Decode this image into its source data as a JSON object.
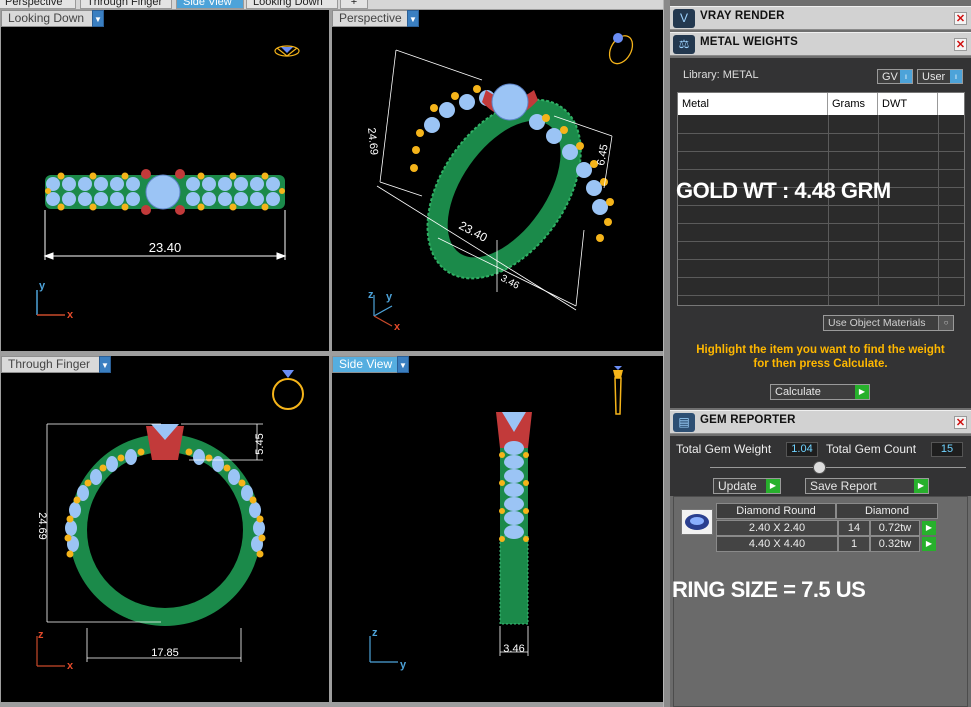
{
  "tabs": [
    "Perspective",
    "Through Finger",
    "Side View",
    "Looking Down",
    "+"
  ],
  "active_tab": "Side View",
  "viewports": {
    "top_left": {
      "label": "Looking Down",
      "dims": {
        "width": "23.40"
      },
      "axes": {
        "v": "y",
        "h": "x"
      }
    },
    "top_right": {
      "label": "Perspective",
      "dims": {
        "height": "24.69",
        "length": "23.40",
        "side": "6.45",
        "width": "3.46"
      },
      "axes": {
        "v": "y",
        "z": "z",
        "h": "x"
      }
    },
    "bottom_left": {
      "label": "Through Finger",
      "dims": {
        "height": "24.69",
        "top": "5.45",
        "width": "17.85"
      },
      "axes": {
        "v": "z",
        "h": "x"
      }
    },
    "bottom_right": {
      "label": "Side View",
      "dims": {
        "width": "3.46"
      },
      "axes": {
        "v": "z",
        "h": "y"
      }
    }
  },
  "overlay": {
    "gold_wt": "GOLD WT : 4.48 GRM",
    "ring_size": "RING SIZE = 7.5 US"
  },
  "vray": {
    "title": "VRAY RENDER"
  },
  "metal": {
    "title": "METAL WEIGHTS",
    "library": "Library: METAL",
    "gv": "GV",
    "user": "User",
    "columns": [
      "Metal",
      "Grams",
      "DWT"
    ],
    "use_object": "Use Object Materials",
    "hint_line1": "Highlight the item you want to find the weight",
    "hint_line2": "for then press Calculate.",
    "calculate": "Calculate"
  },
  "gem": {
    "title": "GEM REPORTER",
    "total_weight_label": "Total Gem Weight",
    "total_weight": "1.04",
    "total_count_label": "Total Gem Count",
    "total_count": "15",
    "update": "Update",
    "save_report": "Save Report",
    "header_left": "Diamond Round",
    "header_right": "Diamond",
    "rows": [
      {
        "size": "2.40 X 2.40",
        "count": "14",
        "weight": "0.72tw"
      },
      {
        "size": "4.40 X 4.40",
        "count": "1",
        "weight": "0.32tw"
      }
    ]
  },
  "colors": {
    "band": "#1b8a4a",
    "gem": "#9bc4f5",
    "prong": "#f5b41a",
    "head": "#c23a3a",
    "accent": "#4da3d9"
  }
}
